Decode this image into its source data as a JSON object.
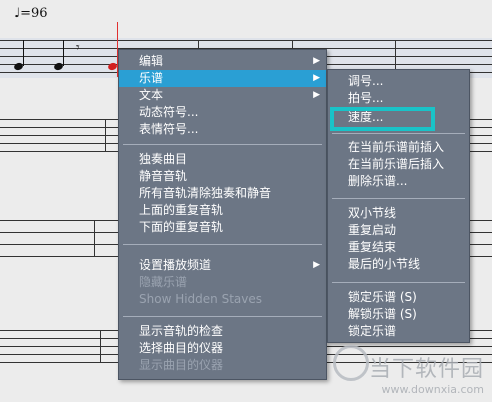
{
  "score": {
    "tempo_value": "=96"
  },
  "context_menu": {
    "items": [
      {
        "label": "编辑",
        "submenu": true
      },
      {
        "label": "乐谱",
        "submenu": true
      },
      {
        "label": "文本",
        "submenu": true
      },
      {
        "label": "动态符号...",
        "submenu": false
      },
      {
        "label": "表情符号...",
        "submenu": false
      },
      {
        "label": "独奏曲目",
        "submenu": false
      },
      {
        "label": "静音音轨",
        "submenu": false
      },
      {
        "label": "所有音轨清除独奏和静音",
        "submenu": false
      },
      {
        "label": "上面的重复音轨",
        "submenu": false
      },
      {
        "label": "下面的重复音轨",
        "submenu": false
      },
      {
        "label": "设置播放频道",
        "submenu": true
      },
      {
        "label": "隐藏乐谱",
        "submenu": false
      },
      {
        "label": "Show Hidden Staves",
        "submenu": false
      },
      {
        "label": "显示音轨的检查",
        "submenu": false
      },
      {
        "label": "选择曲目的仪器",
        "submenu": false
      },
      {
        "label": "显示曲目的仪器",
        "submenu": false
      }
    ]
  },
  "score_submenu": {
    "items": [
      {
        "label": "调号..."
      },
      {
        "label": "拍号..."
      },
      {
        "label": "速度..."
      },
      {
        "label": "在当前乐谱前插入"
      },
      {
        "label": "在当前乐谱后插入"
      },
      {
        "label": "删除乐谱..."
      },
      {
        "label": "双小节线"
      },
      {
        "label": "重复启动"
      },
      {
        "label": "重复结束"
      },
      {
        "label": "最后的小节线"
      },
      {
        "label": "锁定乐谱 (S)"
      },
      {
        "label": "解锁乐谱 (S)"
      },
      {
        "label": "锁定乐谱"
      }
    ]
  },
  "watermark": {
    "name": "当下软件园",
    "url": "www.downxia.com"
  },
  "colors": {
    "menu_bg": "#6c7685",
    "highlight": "#2a9fd4",
    "annotation_box": "#19c3c8",
    "cursor": "#e03030"
  }
}
